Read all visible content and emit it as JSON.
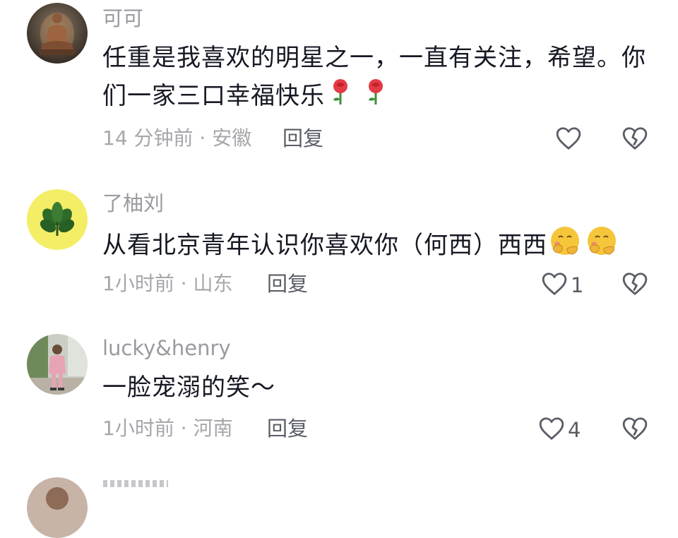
{
  "comments": [
    {
      "username": "可可",
      "text": "任重是我喜欢的明星之一，一直有关注，希望。你们一家三口幸福快乐",
      "emojis": [
        "rose-emoji",
        "rose-emoji"
      ],
      "time": "14 分钟前",
      "location": "安徽",
      "meta": "14 分钟前 · 安徽",
      "reply_label": "回复",
      "likes": "",
      "avatar_icon": "buddha-statue-avatar"
    },
    {
      "username": "了柚刘",
      "text": "从看北京青年认识你喜欢你（何西）西西",
      "emojis": [
        "shy-face-emoji",
        "shy-face-emoji"
      ],
      "time": "1小时前",
      "location": "山东",
      "meta": "1小时前 · 山东",
      "reply_label": "回复",
      "likes": "1",
      "avatar_icon": "green-leaves-avatar"
    },
    {
      "username": "lucky&henry",
      "text": "一脸宠溺的笑～",
      "emojis": [],
      "time": "1小时前",
      "location": "河南",
      "meta": "1小时前 · 河南",
      "reply_label": "回复",
      "likes": "4",
      "avatar_icon": "person-photo-avatar"
    },
    {
      "username": "",
      "text": "",
      "partial": true
    }
  ],
  "colors": {
    "text": "#161823",
    "username": "#9a9aa0",
    "meta": "#a6a6ab",
    "icon": "#5a5d66"
  }
}
